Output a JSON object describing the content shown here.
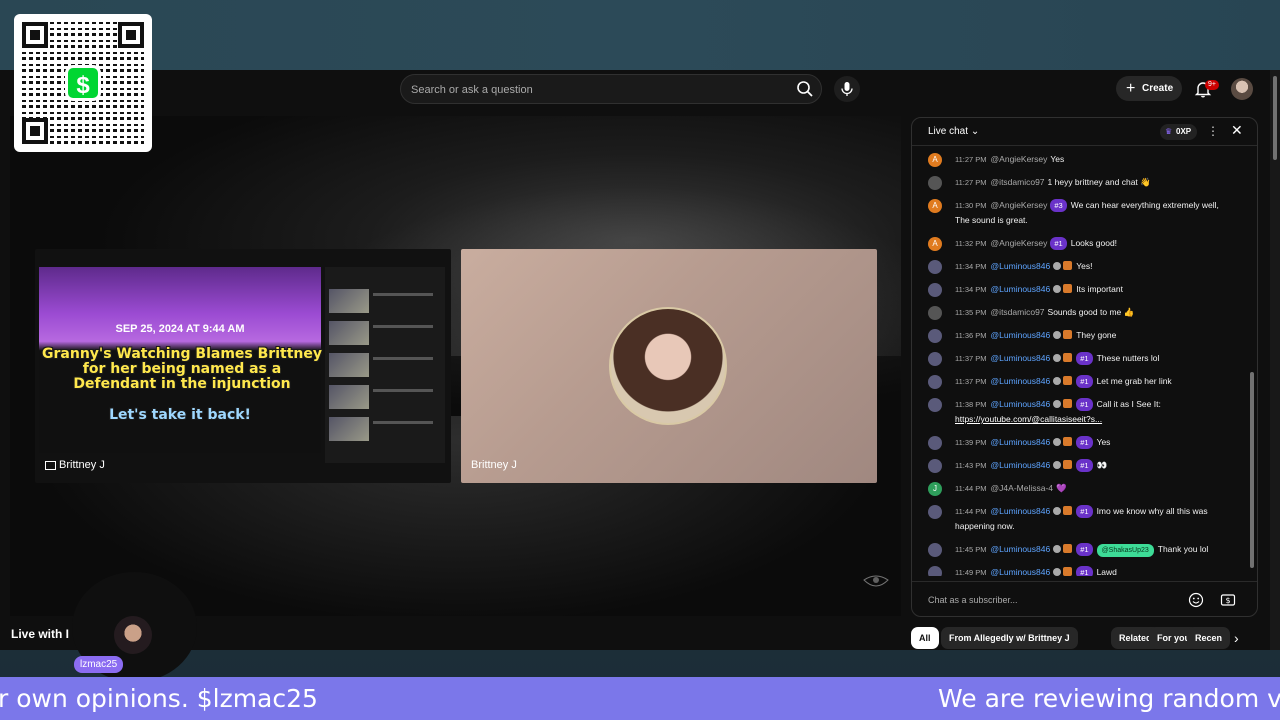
{
  "search": {
    "placeholder": "Search or ask a question"
  },
  "header": {
    "create_label": "Create",
    "notif_badge": "9+"
  },
  "video": {
    "left_tile_label": "Brittney J",
    "right_tile_label": "Brittney J",
    "screen_date": "SEP 25, 2024 AT 9:44 AM",
    "screen_headline": "Granny's Watching Blames Brittney for her being named as a Defendant in the injunction",
    "screen_subline": "Let's take it back!"
  },
  "stream": {
    "title": "Live with I",
    "overlay_name": "lzmac25"
  },
  "chat": {
    "title": "Live chat",
    "xp": "0XP",
    "input_placeholder": "Chat as a subscriber...",
    "messages": [
      {
        "time": "11:27 PM",
        "author": "@AngieKersey",
        "avatar": "A",
        "color": "#e07b1f",
        "member": false,
        "rank": "",
        "text": "Yes"
      },
      {
        "time": "11:27 PM",
        "author": "@itsdamico97",
        "avatar": "",
        "color": "#555555",
        "member": false,
        "rank": "",
        "text": "1 heyy brittney and chat 👋"
      },
      {
        "time": "11:30 PM",
        "author": "@AngieKersey",
        "avatar": "A",
        "color": "#e07b1f",
        "member": false,
        "rank": "#3",
        "text": "We can hear everything extremely well, The sound is great."
      },
      {
        "time": "11:32 PM",
        "author": "@AngieKersey",
        "avatar": "A",
        "color": "#e07b1f",
        "member": false,
        "rank": "#1",
        "text": "Looks good!"
      },
      {
        "time": "11:34 PM",
        "author": "@Luminous846",
        "avatar": "",
        "color": "#5a5a7a",
        "member": true,
        "rank": "",
        "text": "Yes!"
      },
      {
        "time": "11:34 PM",
        "author": "@Luminous846",
        "avatar": "",
        "color": "#5a5a7a",
        "member": true,
        "rank": "",
        "text": "Its important"
      },
      {
        "time": "11:35 PM",
        "author": "@itsdamico97",
        "avatar": "",
        "color": "#555555",
        "member": false,
        "rank": "",
        "text": "Sounds good to me 👍"
      },
      {
        "time": "11:36 PM",
        "author": "@Luminous846",
        "avatar": "",
        "color": "#5a5a7a",
        "member": true,
        "rank": "",
        "text": "They gone"
      },
      {
        "time": "11:37 PM",
        "author": "@Luminous846",
        "avatar": "",
        "color": "#5a5a7a",
        "member": true,
        "rank": "#1",
        "text": "These nutters lol"
      },
      {
        "time": "11:37 PM",
        "author": "@Luminous846",
        "avatar": "",
        "color": "#5a5a7a",
        "member": true,
        "rank": "#1",
        "text": "Let me grab her link"
      },
      {
        "time": "11:38 PM",
        "author": "@Luminous846",
        "avatar": "",
        "color": "#5a5a7a",
        "member": true,
        "rank": "#1",
        "text": "Call it as I See It: ",
        "link": "https://youtube.com/@callitasiseeit?s..."
      },
      {
        "time": "11:39 PM",
        "author": "@Luminous846",
        "avatar": "",
        "color": "#5a5a7a",
        "member": true,
        "rank": "#1",
        "text": "Yes"
      },
      {
        "time": "11:43 PM",
        "author": "@Luminous846",
        "avatar": "",
        "color": "#5a5a7a",
        "member": true,
        "rank": "#1",
        "text": "👀"
      },
      {
        "time": "11:44 PM",
        "author": "@J4A-Melissa-4",
        "avatar": "J",
        "color": "#2e9e5b",
        "member": false,
        "rank": "",
        "text": "💜"
      },
      {
        "time": "11:44 PM",
        "author": "@Luminous846",
        "avatar": "",
        "color": "#5a5a7a",
        "member": true,
        "rank": "#1",
        "text": "Imo we know why all this was happening now."
      },
      {
        "time": "11:45 PM",
        "author": "@Luminous846",
        "avatar": "",
        "color": "#5a5a7a",
        "member": true,
        "rank": "#1",
        "mention": "@ShakasUp23",
        "text": "Thank you lol"
      },
      {
        "time": "11:49 PM",
        "author": "@Luminous846",
        "avatar": "",
        "color": "#5a5a7a",
        "member": true,
        "rank": "#1",
        "text": "Lawd"
      }
    ]
  },
  "chips": [
    "All",
    "From Allegedly w/ Brittney J",
    "Related",
    "For you",
    "Recen"
  ],
  "ticker": {
    "left": "r own opinions. $lzmac25",
    "right": "We are reviewing random vid"
  },
  "colors": {
    "accent": "#7b77ea",
    "cashapp": "#00d632",
    "rank_badge": "#6a32c9",
    "member_name": "#5ea4ff"
  }
}
